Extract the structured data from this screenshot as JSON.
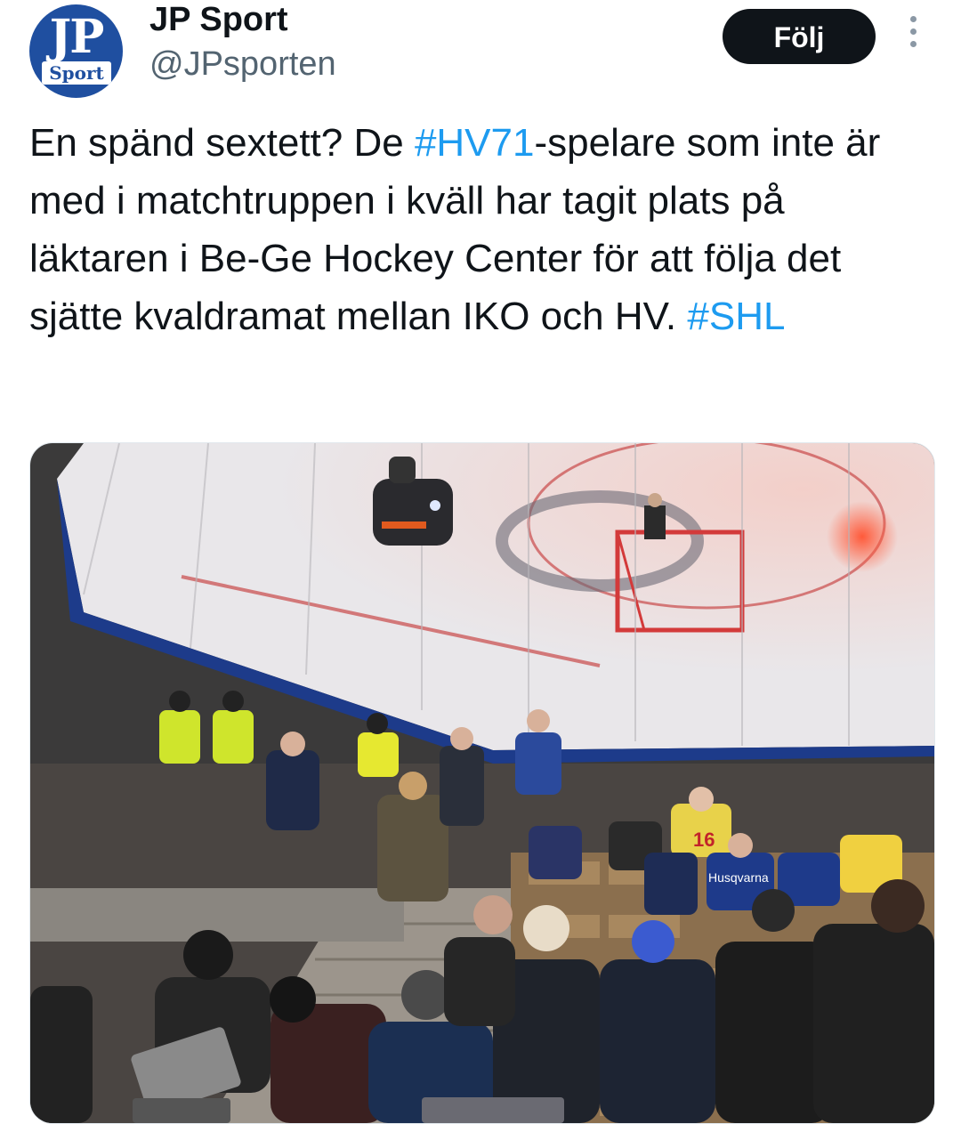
{
  "author": {
    "name": "JP Sport",
    "handle": "@JPsporten",
    "avatar": {
      "logo_top": "JP",
      "logo_bottom": "Sport",
      "color": "#1f4fa0"
    }
  },
  "actions": {
    "follow_label": "Följ",
    "more_icon": "more-vertical-icon"
  },
  "tweet": {
    "text_1": "En spänd sextett? De ",
    "hashtag_1": "#HV71",
    "text_2": "-spelare som inte är med i matchtruppen i kväll har tagit plats på läktaren i Be-Ge Hockey Center för att följa det sjätte kvaldramat mellan IKO och HV. ",
    "hashtag_2": "#SHL",
    "hashtag_color": "#1d9bf0"
  },
  "media": {
    "sign_text": "Husqvarna",
    "jersey_number": "16"
  }
}
